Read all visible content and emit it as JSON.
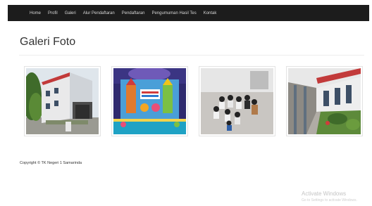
{
  "nav": {
    "items": [
      {
        "label": "Home"
      },
      {
        "label": "Profil"
      },
      {
        "label": "Galeri"
      },
      {
        "label": "Alur Pendaftaran"
      },
      {
        "label": "Pendaftaran"
      },
      {
        "label": "Pengumuman Hasil Tes"
      },
      {
        "label": "Kontak"
      }
    ]
  },
  "page": {
    "title": "Galeri Foto"
  },
  "gallery": {
    "photos": [
      {
        "subject": "school-building"
      },
      {
        "subject": "stage-decoration"
      },
      {
        "subject": "children-classroom"
      },
      {
        "subject": "school-corridor"
      }
    ]
  },
  "footer": {
    "copyright": "Copyright © TK Negeri 1 Samarinda"
  },
  "watermark": {
    "title": "Activate Windows",
    "subtitle": "Go to Settings to activate Windows."
  }
}
